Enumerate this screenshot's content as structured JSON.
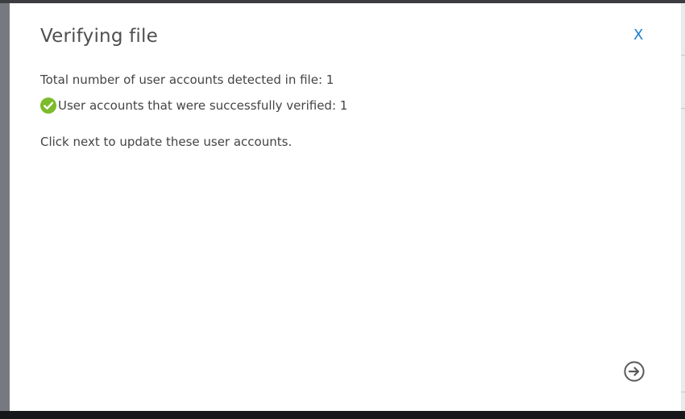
{
  "dialog": {
    "title": "Verifying file",
    "close_label": "X",
    "total_line": "Total number of user accounts detected in file: 1",
    "verified_line": "User accounts that were successfully verified: 1",
    "instruction": "Click next to update these user accounts."
  },
  "icons": {
    "success": "check-circle-icon",
    "next": "arrow-right-circle-icon"
  },
  "colors": {
    "title": "#4f4f4f",
    "text": "#444444",
    "close": "#1f7fcf",
    "success": "#7cbb2a",
    "next_icon": "#5a5a5a",
    "overlay": "#767a80"
  }
}
